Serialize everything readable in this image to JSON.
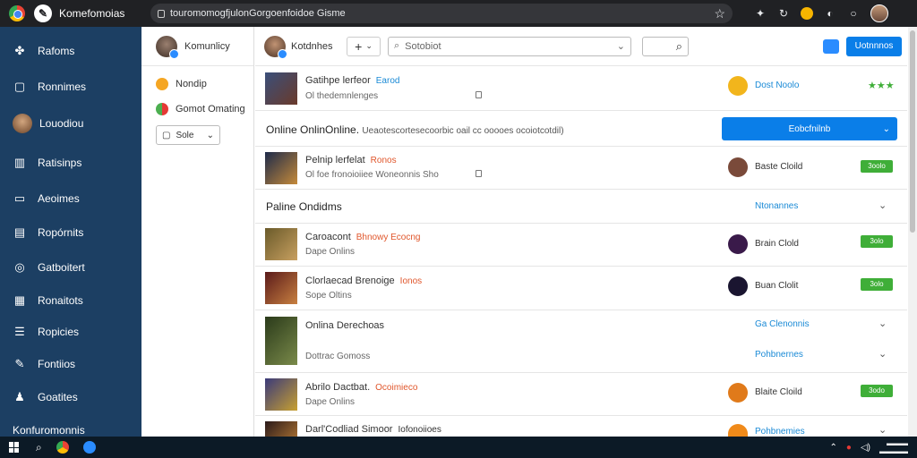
{
  "browser": {
    "app_title": "Komefomoias",
    "url": "touromomogfjulonGorgoenfoidoe Gisme"
  },
  "sidebar": {
    "items": [
      {
        "label": "Rafoms",
        "icon": "puzzle-icon"
      },
      {
        "label": "Ronnimes",
        "icon": "square-icon"
      },
      {
        "label": "Louodiou",
        "icon": "avatar"
      },
      {
        "label": "Ratisinps",
        "icon": "chart-icon"
      },
      {
        "label": "Aeoimes",
        "icon": "window-icon"
      },
      {
        "label": "Ropórnits",
        "icon": "doc-icon"
      },
      {
        "label": "Gatboitert",
        "icon": "globe-icon"
      },
      {
        "label": "Ronaitots",
        "icon": "grid-icon"
      },
      {
        "label": "Ropicies",
        "icon": "list-icon"
      },
      {
        "label": "Fontiios",
        "icon": "pen-icon"
      },
      {
        "label": "Goatites",
        "icon": "person-icon"
      }
    ],
    "footer": "Konfuromonnis"
  },
  "panel2": {
    "title": "Komunlicy",
    "items": [
      {
        "label": "Nondip",
        "color": "#f5a623"
      },
      {
        "label": "Gomot Omating",
        "color": "#4caf50"
      }
    ],
    "dropdown_label": "Sole"
  },
  "main": {
    "header_title": "Kotdnhes",
    "search_placeholder": "Sotobiot",
    "primary_button": "Uotnnnos"
  },
  "rows": [
    {
      "name": "Gatihpe lerfeor",
      "tag": "Earod",
      "tag_color": "#1a8ad6",
      "sub": "Ol thedemnlenges",
      "right_label": "Dost Noolo",
      "right_label_color": "#1a8ad6",
      "rating": "★★★",
      "right_color": "#f2b51c",
      "thumb": [
        "#3a4f7a",
        "#6a3a2a"
      ]
    },
    {
      "section": "Online OnlinOnline.",
      "section_desc": "Ueaotescortesecoorbic oail cc ooooes ocoiotcotdil)",
      "cta": "Eobcfnilnb"
    },
    {
      "name": "Pelnip lerfelat",
      "tag": "Ronos",
      "tag_color": "#e0562b",
      "sub": "Ol foe fronoioiiee  Woneonnis Sho",
      "right_label": "Baste Cloild",
      "badge": "3oolo",
      "right_color": "#7a4a3a",
      "thumb": [
        "#1d2a4a",
        "#c58a3a"
      ]
    },
    {
      "section": "Paline Ondidms",
      "link": "Ntonannes"
    },
    {
      "name": "Caroacont",
      "tag": "Bhnowy Ecocng",
      "tag_color": "#e0562b",
      "sub": "Dape Onlins",
      "right_label": "Brain Clold",
      "badge": "3olo",
      "right_color": "#3a1a4a",
      "thumb": [
        "#6a5a2a",
        "#c8a060"
      ]
    },
    {
      "name": "Clorlaecad Brenoige",
      "tag": "Ionos",
      "tag_color": "#e0562b",
      "sub": "Sope Oltins",
      "right_label": "Buan Clolit",
      "badge": "3olo",
      "right_color": "#1a1530",
      "thumb": [
        "#5a1a1a",
        "#c88040"
      ]
    },
    {
      "section": "Onlina Derechoas",
      "section2": "Dottrac Gomoss",
      "link": "Ga Clenonnis",
      "link2": "Pohbnernes"
    },
    {
      "name": "Abrilo Dactbat.",
      "tag": "Ocoimieco",
      "tag_color": "#e0562b",
      "sub": "Dape Onlins",
      "right_label": "Blaite Cloild",
      "badge": "3odo",
      "right_color": "#e07a1a",
      "thumb": [
        "#3a3a7a",
        "#c8a030"
      ]
    },
    {
      "name": "Darl'Codliad Simoor",
      "tag": "Iofonoiioes",
      "tag_color": "#333333",
      "link": "Pohbnemies",
      "right_color": "#f08a1a",
      "thumb": [
        "#2a1a1a",
        "#a06a30"
      ]
    }
  ]
}
